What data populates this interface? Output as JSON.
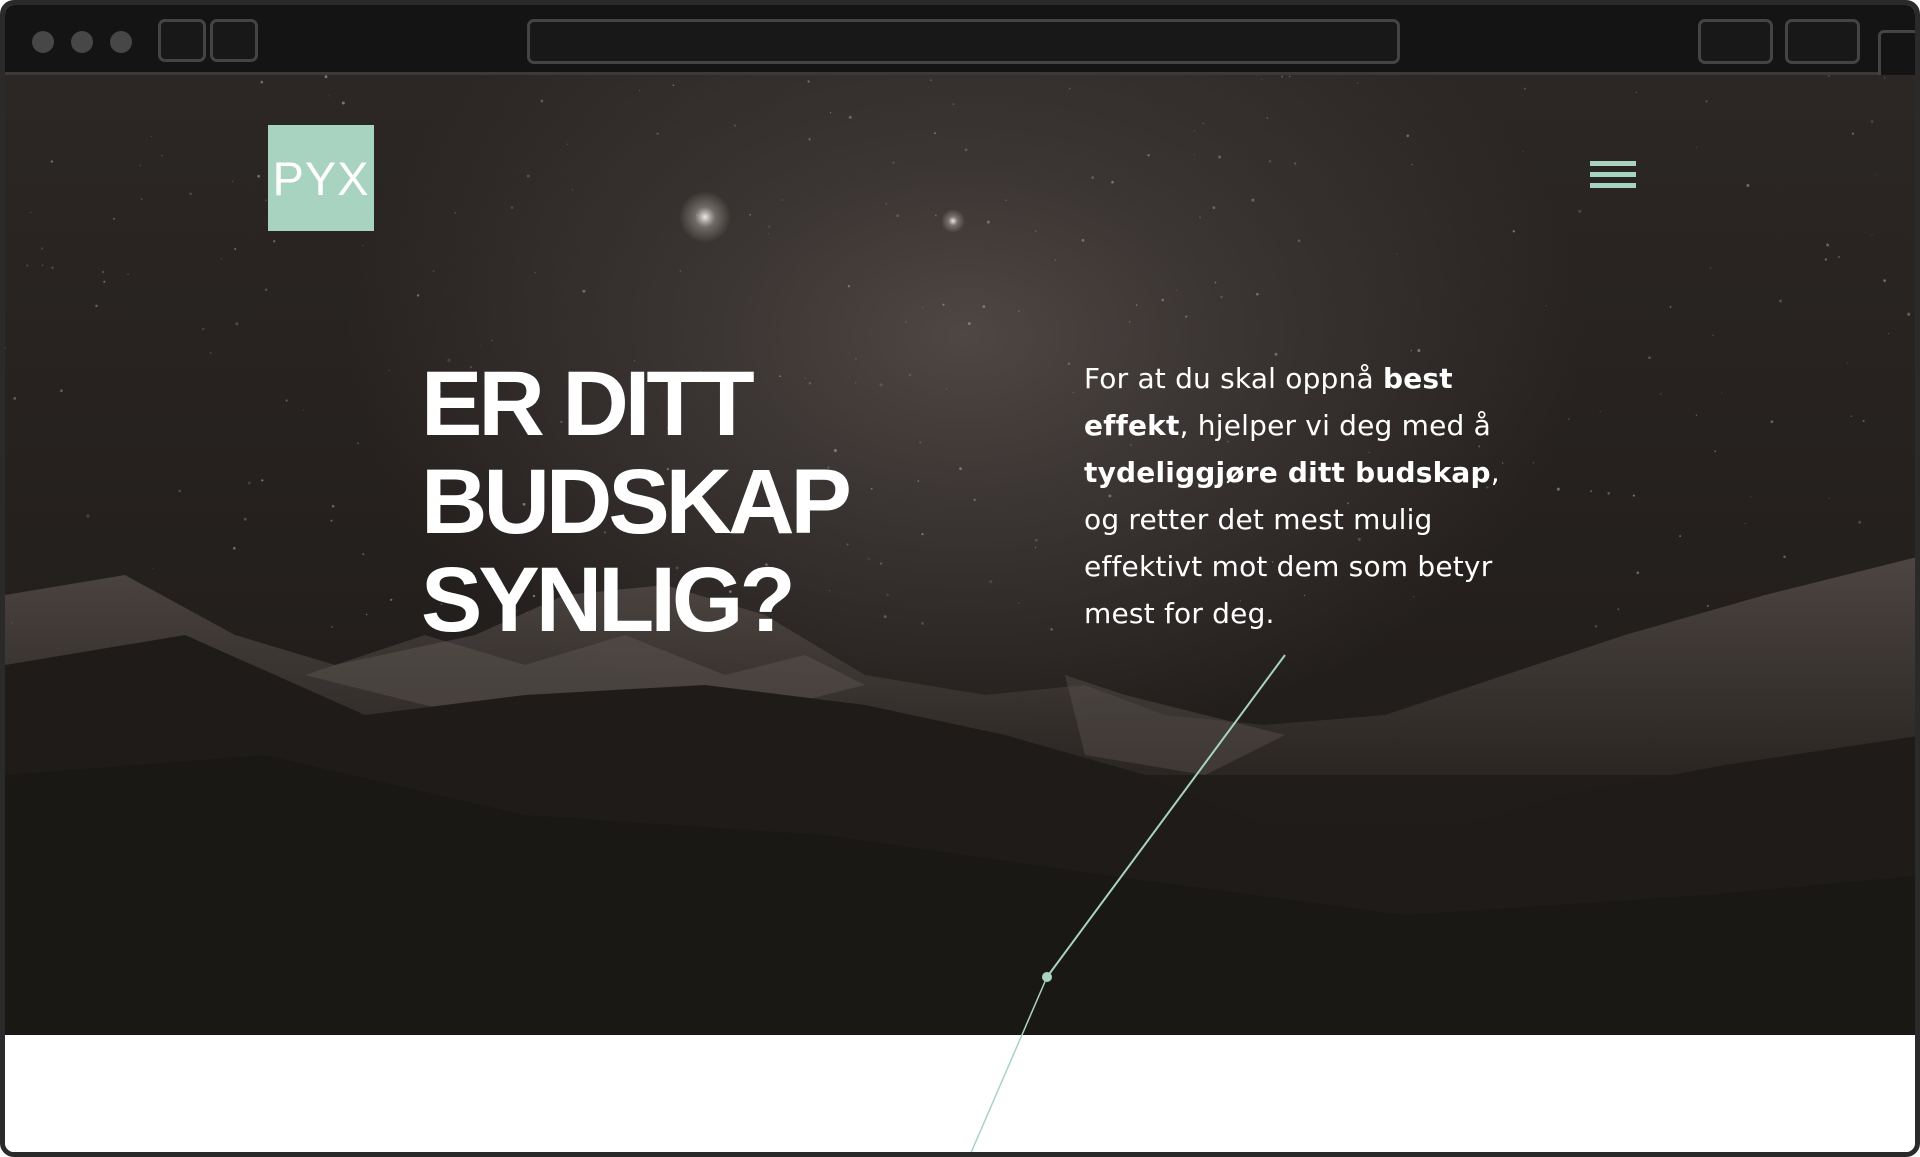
{
  "brand": {
    "logo_text": "PYX",
    "accent": "#a8d3c1"
  },
  "nav": {
    "menu_icon": "hamburger-menu-icon"
  },
  "hero": {
    "headline_lines": [
      "ER DITT",
      "BUDSKAP",
      "SYNLIG?"
    ],
    "intro": {
      "p1": "For at du skal oppnå ",
      "b1": "best effekt",
      "p2": ", hjelper vi deg med å ",
      "b2": "tydeliggjøre ditt budskap",
      "p3": ", og retter det mest mulig effektivt mot dem som betyr mest for deg."
    }
  },
  "colors": {
    "hero_dark": "#211d1b",
    "text": "#ffffff",
    "page": "#ffffff"
  }
}
